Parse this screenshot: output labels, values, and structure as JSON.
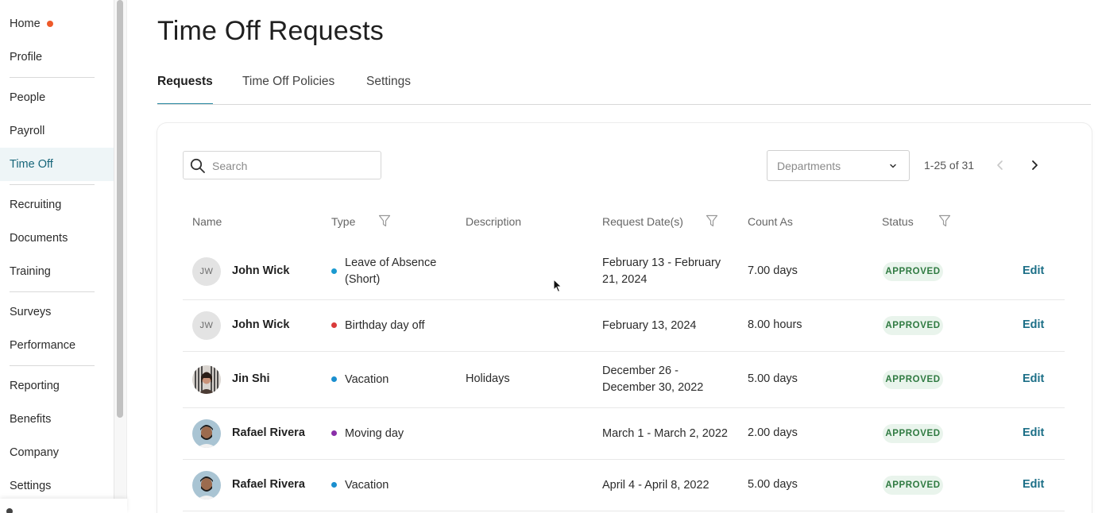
{
  "sidebar": {
    "items": [
      {
        "label": "Home"
      },
      {
        "label": "Profile"
      },
      {
        "label": "People"
      },
      {
        "label": "Payroll"
      },
      {
        "label": "Time Off"
      },
      {
        "label": "Recruiting"
      },
      {
        "label": "Documents"
      },
      {
        "label": "Training"
      },
      {
        "label": "Surveys"
      },
      {
        "label": "Performance"
      },
      {
        "label": "Reporting"
      },
      {
        "label": "Benefits"
      },
      {
        "label": "Company"
      },
      {
        "label": "Settings"
      }
    ],
    "active": "Time Off",
    "notification_color": "#ee5a2a"
  },
  "page": {
    "title": "Time Off Requests"
  },
  "tabs": [
    {
      "label": "Requests",
      "active": true
    },
    {
      "label": "Time Off Policies",
      "active": false
    },
    {
      "label": "Settings",
      "active": false
    }
  ],
  "toolbar": {
    "search_placeholder": "Search",
    "departments_placeholder": "Departments",
    "pagination": "1-25 of 31"
  },
  "table": {
    "columns": [
      "Name",
      "Type",
      "Description",
      "Request Date(s)",
      "Count As",
      "Status"
    ],
    "rows": [
      {
        "initials": "JW",
        "name": "John Wick",
        "type": "Leave of Absence (Short)",
        "type_color": "#1a9ad0",
        "description": "",
        "dates": "February 13 - February 21, 2024",
        "count": "7.00 days",
        "status": "APPROVED",
        "action": "Edit"
      },
      {
        "initials": "JW",
        "name": "John Wick",
        "type": "Birthday day off",
        "type_color": "#d93a3a",
        "description": "",
        "dates": "February 13, 2024",
        "count": "8.00 hours",
        "status": "APPROVED",
        "action": "Edit"
      },
      {
        "initials": "",
        "name": "Jin Shi",
        "type": "Vacation",
        "type_color": "#1a8fcf",
        "description": "Holidays",
        "dates": "December 26 - December 30, 2022",
        "count": "5.00 days",
        "status": "APPROVED",
        "action": "Edit"
      },
      {
        "initials": "",
        "name": "Rafael Rivera",
        "type": "Moving day",
        "type_color": "#8a2ea8",
        "description": "",
        "dates": "March 1 - March 2, 2022",
        "count": "2.00 days",
        "status": "APPROVED",
        "action": "Edit"
      },
      {
        "initials": "",
        "name": "Rafael Rivera",
        "type": "Vacation",
        "type_color": "#1a8fcf",
        "description": "",
        "dates": "April 4 - April 8, 2022",
        "count": "5.00 days",
        "status": "APPROVED",
        "action": "Edit"
      }
    ]
  },
  "colors": {
    "accent": "#2b8aa3",
    "link": "#1c6f87",
    "approved_bg": "#e9f4ec",
    "approved_text": "#2f7a41"
  }
}
